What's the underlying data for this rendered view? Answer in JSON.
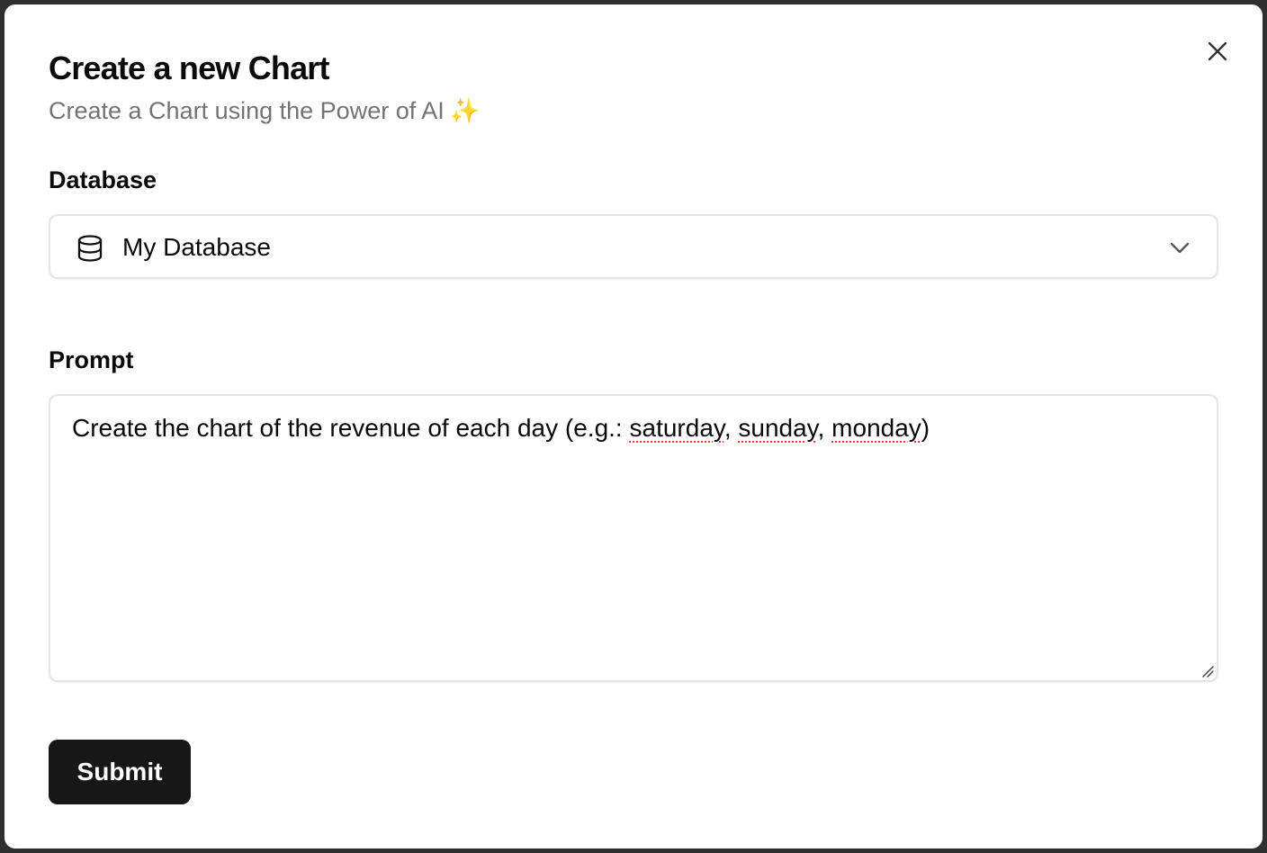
{
  "dialog": {
    "title": "Create a new Chart",
    "subtitle": "Create a Chart using the Power of AI",
    "subtitle_emoji": "✨"
  },
  "database": {
    "label": "Database",
    "selected": "My Database",
    "icon": "database-icon",
    "dropdown_icon": "chevron-down-icon"
  },
  "prompt": {
    "label": "Prompt",
    "value_plain": "Create the chart of the revenue of each day (e.g.: ",
    "word1": "saturday",
    "sep1": ", ",
    "word2": "sunday",
    "sep2": ", ",
    "word3": "monday",
    "close": ")"
  },
  "actions": {
    "submit_label": "Submit",
    "close_icon": "close-icon"
  },
  "colors": {
    "primary_button": "#171717",
    "subtitle_text": "#737373",
    "border": "#e5e5e5",
    "spellcheck": "#e04040"
  }
}
